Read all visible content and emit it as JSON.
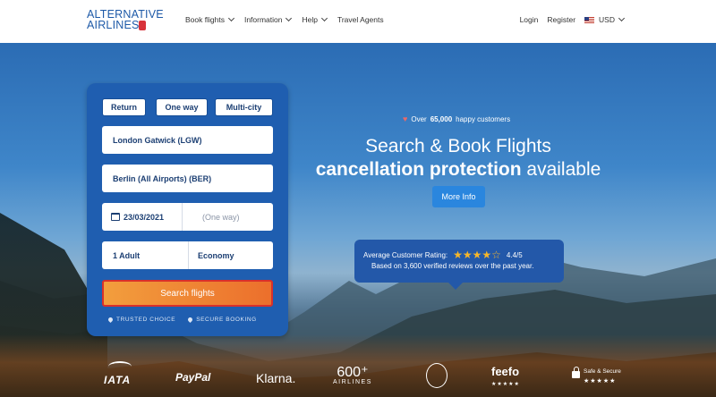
{
  "header": {
    "logo_line1": "ALTERNATIVE",
    "logo_line2": "AIRLINES",
    "nav": [
      {
        "label": "Book flights"
      },
      {
        "label": "Information"
      },
      {
        "label": "Help"
      },
      {
        "label": "Travel Agents"
      }
    ],
    "login": "Login",
    "register": "Register",
    "currency": "USD"
  },
  "search": {
    "trip_types": [
      "Return",
      "One way",
      "Multi-city"
    ],
    "origin": "London Gatwick (LGW)",
    "destination": "Berlin (All Airports) (BER)",
    "depart_date": "23/03/2021",
    "return_date": "(One way)",
    "passengers": "1 Adult",
    "cabin": "Economy",
    "search_label": "Search flights",
    "badge_trusted": "TRUSTED CHOICE",
    "badge_secure": "SECURE BOOKING"
  },
  "hero": {
    "happy_prefix": "Over",
    "happy_count": "65,000",
    "happy_suffix": "happy customers",
    "title": "Search & Book Flights",
    "subtitle_bold": "cancellation protection",
    "subtitle_rest": "available",
    "more_info": "More Info"
  },
  "rating": {
    "label": "Average Customer Rating:",
    "stars": "★★★★☆",
    "score": "4.4/5",
    "reviews": "Based on 3,600 verified reviews over the past year."
  },
  "partners": {
    "iata": "IATA",
    "paypal": "PayPal",
    "klarna": "Klarna.",
    "airlines_count": "600⁺",
    "airlines_label": "AIRLINES",
    "feefo": "feefo",
    "feefo_stars": "★★★★★",
    "secure": "Safe & Secure",
    "secure_stars": "★★★★★"
  },
  "colors": {
    "brand_blue": "#1e5aa8",
    "panel_blue": "#1f5eb0",
    "search_orange": "#ec6f2c",
    "star_gold": "#f5b62b"
  }
}
